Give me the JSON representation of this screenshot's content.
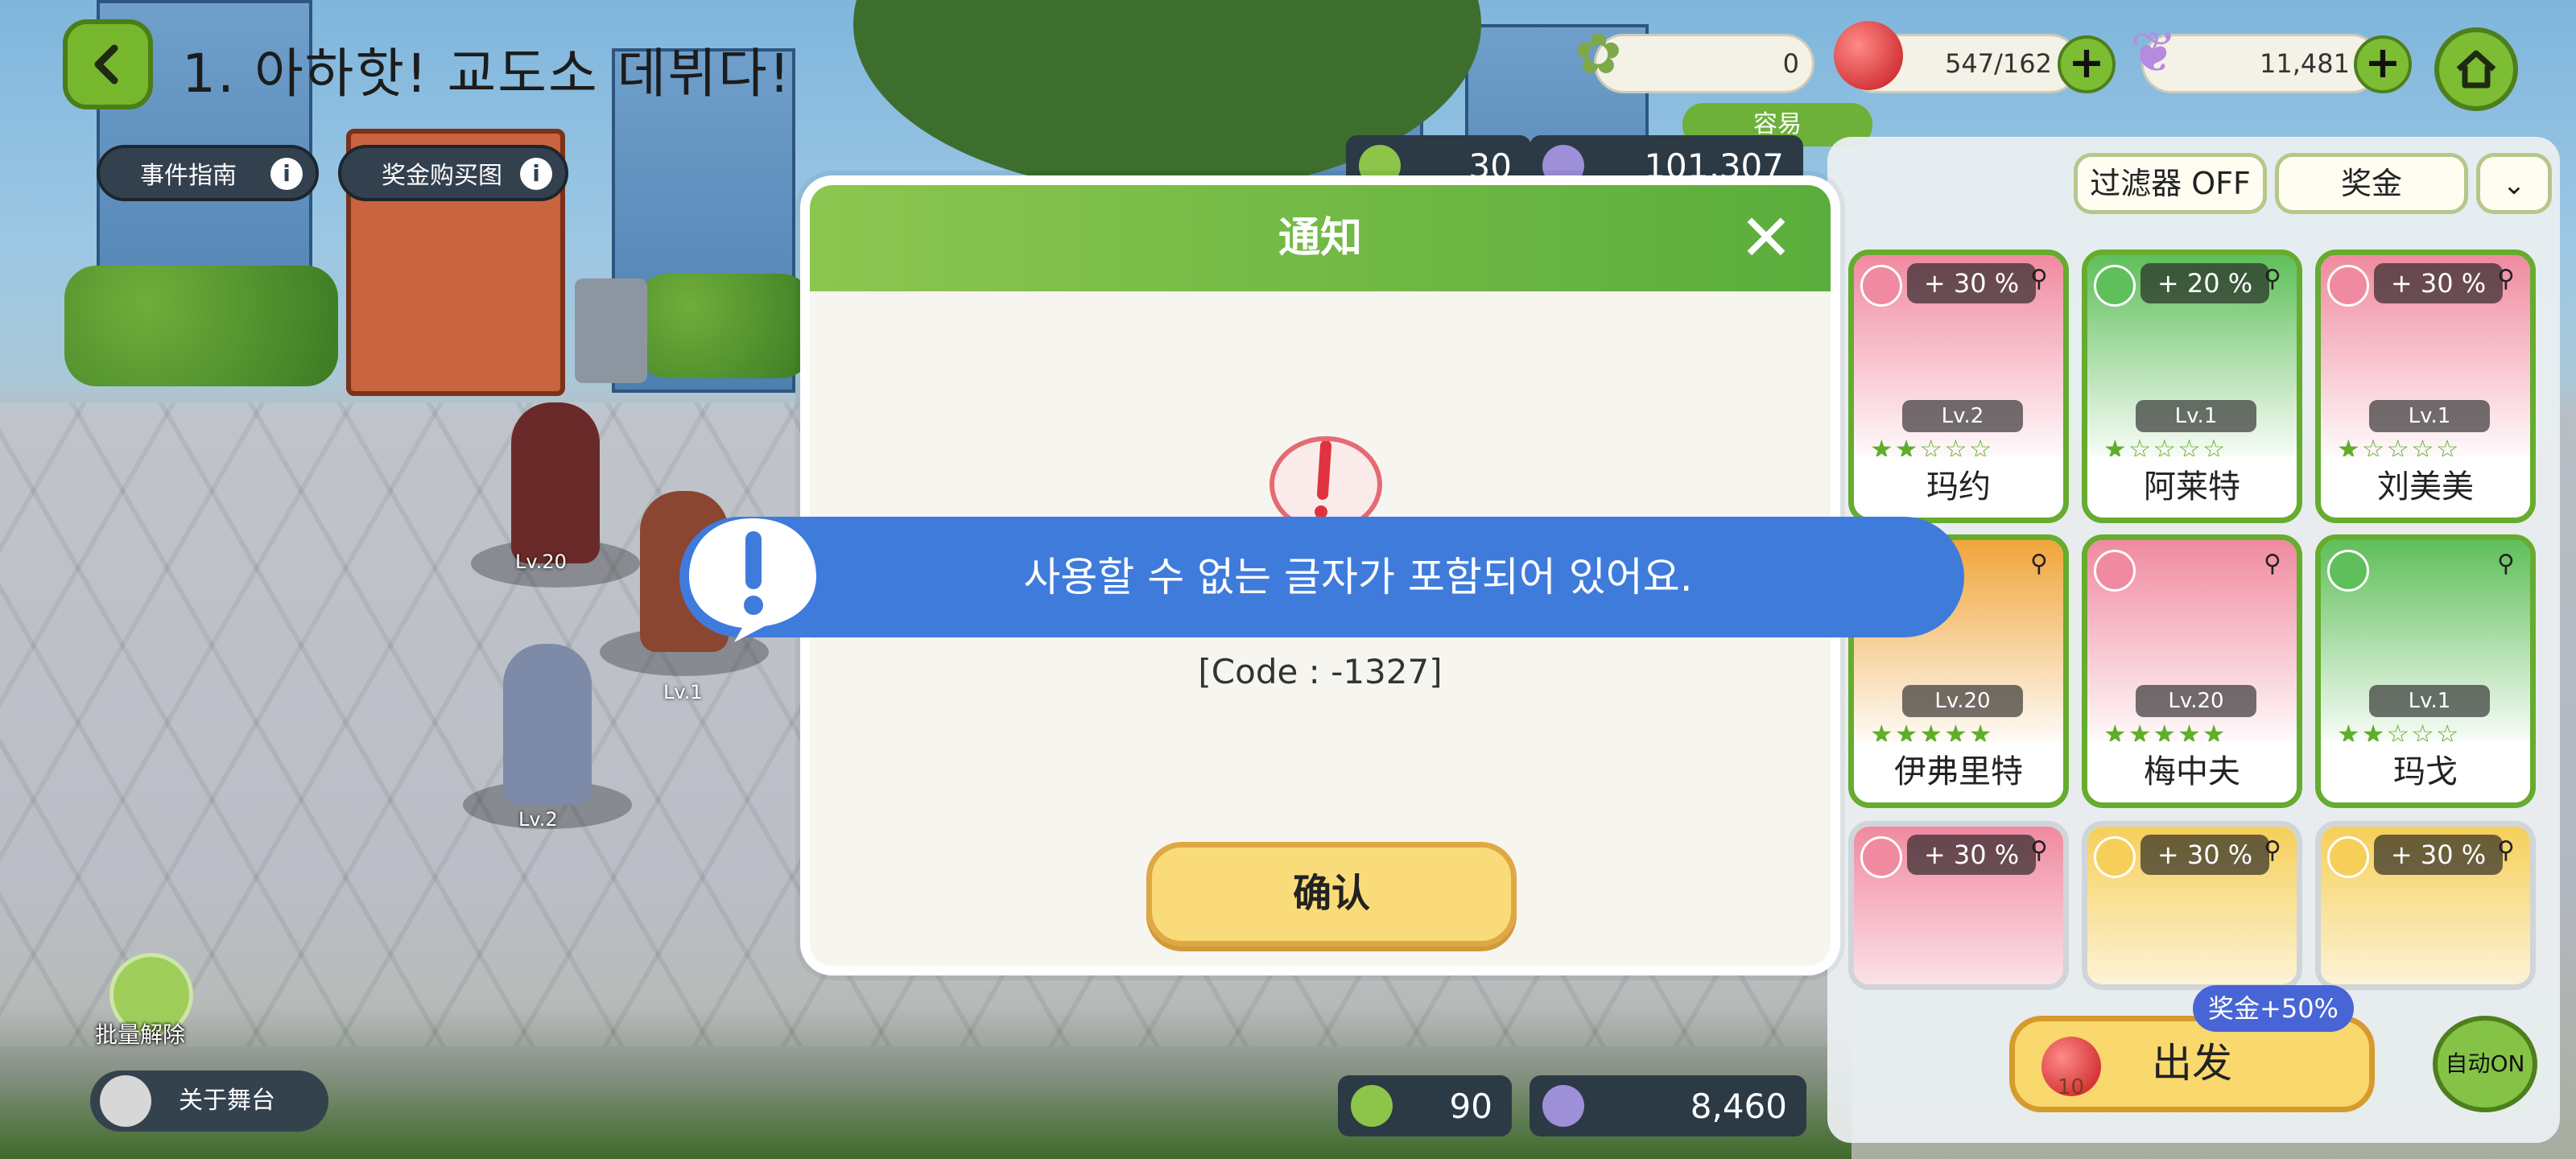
{
  "header": {
    "stage_title": "1. 아하핫! 교도소 데뷔다!",
    "event_guide": "事件指南",
    "reward_map": "奖金购买图"
  },
  "resources": {
    "clover_value": "0",
    "stamina_value": "547/162",
    "gem_value": "11,481",
    "difficulty": "容易"
  },
  "counters": {
    "top_coin": "30",
    "top_power": "101,307",
    "bottom_coin": "90",
    "bottom_power": "8,460"
  },
  "panel": {
    "filter_label": "过滤器 OFF",
    "reward_label": "奖金",
    "cards": [
      {
        "name": "玛约",
        "bonus": "+ 30 %",
        "level": "Lv.2",
        "stars": "★★☆☆☆",
        "color": "#f08aa0"
      },
      {
        "name": "阿莱特",
        "bonus": "+ 20 %",
        "level": "Lv.1",
        "stars": "★☆☆☆☆",
        "color": "#5fbf5a"
      },
      {
        "name": "刘美美",
        "bonus": "+ 30 %",
        "level": "Lv.1",
        "stars": "★☆☆☆☆",
        "color": "#f08aa0"
      },
      {
        "name": "伊弗里特",
        "bonus": "",
        "level": "Lv.20",
        "stars": "★★★★★",
        "color": "#f0a53a"
      },
      {
        "name": "梅中夫",
        "bonus": "",
        "level": "Lv.20",
        "stars": "★★★★★",
        "color": "#f08aa0"
      },
      {
        "name": "玛戈",
        "bonus": "",
        "level": "Lv.1",
        "stars": "★★☆☆☆",
        "color": "#5fbf5a"
      },
      {
        "name": "",
        "bonus": "+ 30 %",
        "level": "",
        "stars": "",
        "color": "#f08aa0"
      },
      {
        "name": "",
        "bonus": "+ 30 %",
        "level": "",
        "stars": "",
        "color": "#f6cf5a"
      },
      {
        "name": "",
        "bonus": "+ 30 %",
        "level": "",
        "stars": "",
        "color": "#f6cf5a"
      }
    ],
    "go_label": "出发",
    "go_bonus": "奖金+50%",
    "go_cost": "10",
    "auto_label": "自动ON"
  },
  "field": {
    "unlock_all": "批量解除",
    "about_stage": "关于舞台",
    "char_levels": [
      "Lv.20",
      "Lv.1",
      "Lv.2"
    ]
  },
  "dialog": {
    "title": "通知",
    "code": "[Code : -1327]",
    "confirm": "确认"
  },
  "toast": {
    "message": "사용할 수 없는 글자가 포함되어 있어요."
  },
  "colors": {
    "accent_green": "#76b72d",
    "toast_blue": "#3f7bdb",
    "confirm_yellow": "#f9dc79"
  }
}
